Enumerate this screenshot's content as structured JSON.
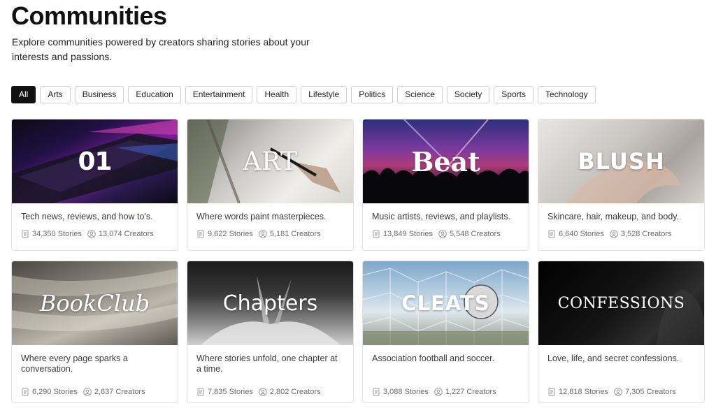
{
  "header": {
    "title": "Communities",
    "subtitle": "Explore communities powered by creators sharing stories about your interests and passions."
  },
  "filters": [
    "All",
    "Arts",
    "Business",
    "Education",
    "Entertainment",
    "Health",
    "Lifestyle",
    "Politics",
    "Science",
    "Society",
    "Sports",
    "Technology"
  ],
  "active_filter": "All",
  "communities": [
    {
      "brand": "01",
      "description": "Tech news, reviews, and how to's.",
      "stories": "34,350 Stories",
      "creators": "13,074 Creators"
    },
    {
      "brand": "ART",
      "description": "Where words paint masterpieces.",
      "stories": "9,622 Stories",
      "creators": "5,181 Creators"
    },
    {
      "brand": "Beat",
      "description": "Music artists, reviews, and playlists.",
      "stories": "13,849 Stories",
      "creators": "5,548 Creators"
    },
    {
      "brand": "BLUSH",
      "description": "Skincare, hair, makeup, and body.",
      "stories": "6,640 Stories",
      "creators": "3,528 Creators"
    },
    {
      "brand": "BookClub",
      "description": "Where every page sparks a conversation.",
      "stories": "6,290 Stories",
      "creators": "2,637 Creators"
    },
    {
      "brand": "Chapters",
      "description": "Where stories unfold, one chapter at a time.",
      "stories": "7,835 Stories",
      "creators": "2,802 Creators"
    },
    {
      "brand": "CLEATS",
      "description": "Association football and soccer.",
      "stories": "3,088 Stories",
      "creators": "1,227 Creators"
    },
    {
      "brand": "CONFESSIONS",
      "description": "Love, life, and secret confessions.",
      "stories": "12,818 Stories",
      "creators": "7,305 Creators"
    }
  ],
  "icons": {
    "stories": "document-icon",
    "creators": "person-icon"
  },
  "colors": {
    "active_chip": "#111111",
    "chip_border": "#cfcfcf",
    "card_border": "#e1e1e1",
    "meta_text": "#6a6a6a"
  }
}
